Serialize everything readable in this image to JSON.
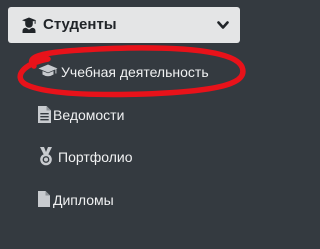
{
  "sidebar": {
    "section": {
      "label": "Студенты",
      "icon": "user-graduate-icon",
      "expanded": true
    },
    "items": [
      {
        "label": "Учебная деятельность",
        "icon": "graduation-cap-icon"
      },
      {
        "label": "Ведомости",
        "icon": "document-list-icon"
      },
      {
        "label": "Портфолио",
        "icon": "medal-icon"
      },
      {
        "label": "Дипломы",
        "icon": "file-icon"
      }
    ]
  },
  "annotation": {
    "shape": "red-ellipse",
    "color": "#e8121a",
    "target": "Учебная деятельность"
  },
  "colors": {
    "sidebar_bg": "#343a40",
    "active_section_bg": "#e4e5e6",
    "text_light": "#f0f1f2",
    "text_dark": "#212529"
  }
}
